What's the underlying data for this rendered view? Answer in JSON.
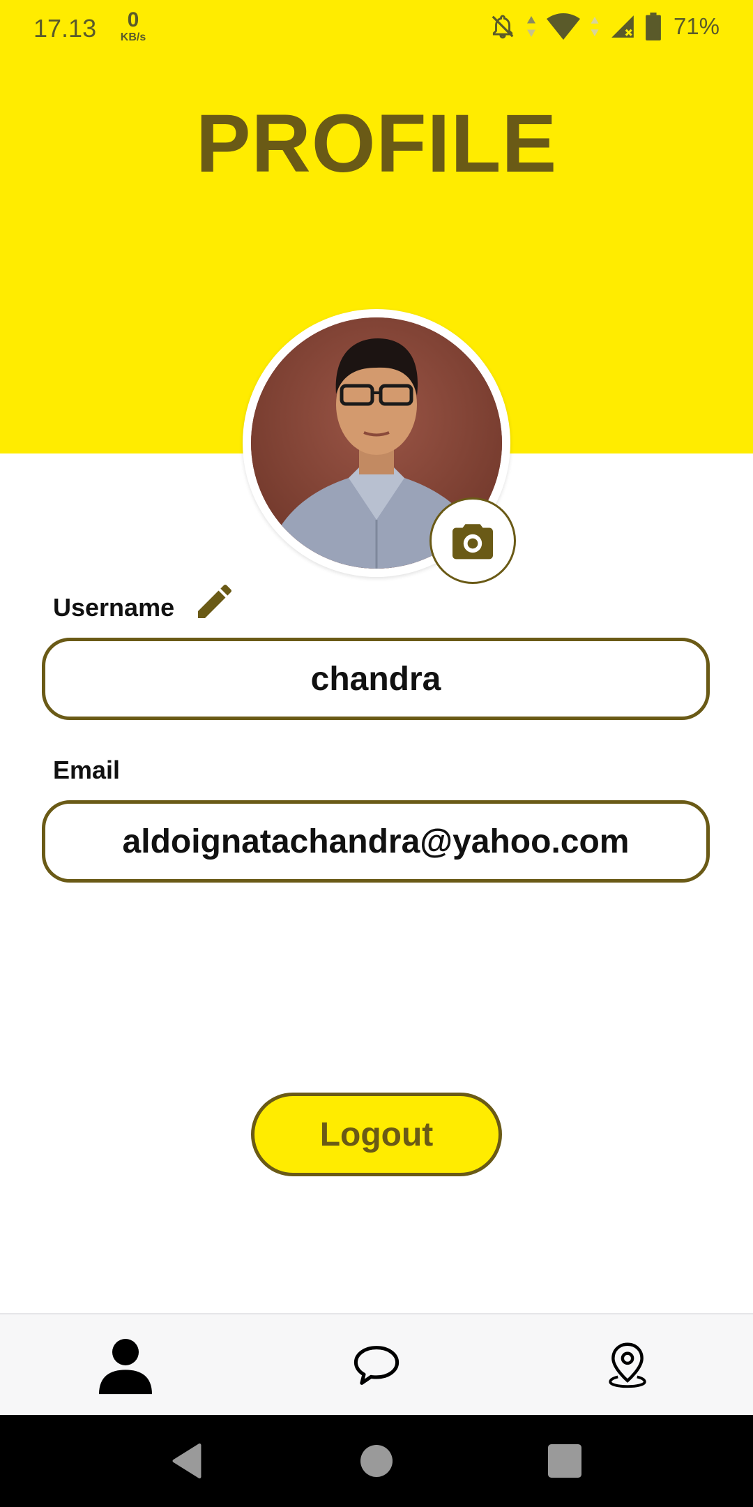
{
  "status_bar": {
    "time": "17.13",
    "net_speed_value": "0",
    "net_speed_unit": "KB/s",
    "battery_percent": "71%",
    "icons": [
      "notifications-off-icon",
      "data-arrows-icon",
      "wifi-icon",
      "cell-signal-icon",
      "battery-icon"
    ]
  },
  "header": {
    "title": "PROFILE",
    "background_color": "#FFEC00",
    "title_color": "#6A5A16"
  },
  "profile": {
    "avatar_icon": "profile-photo",
    "change_photo_icon": "camera-icon",
    "username_label": "Username",
    "edit_icon": "pencil-icon",
    "username_value": "chandra",
    "email_label": "Email",
    "email_value": "aldoignatachandra@yahoo.com"
  },
  "actions": {
    "logout_label": "Logout"
  },
  "bottom_nav": {
    "items": [
      {
        "icon": "person-icon",
        "active": true
      },
      {
        "icon": "chat-bubble-icon",
        "active": false
      },
      {
        "icon": "location-pin-icon",
        "active": false
      }
    ]
  },
  "system_nav": {
    "items": [
      "back-icon",
      "home-icon",
      "recents-icon"
    ]
  },
  "colors": {
    "accent": "#FFEC00",
    "brand_dark": "#6A5A16",
    "nav_background": "#F7F7F8"
  }
}
